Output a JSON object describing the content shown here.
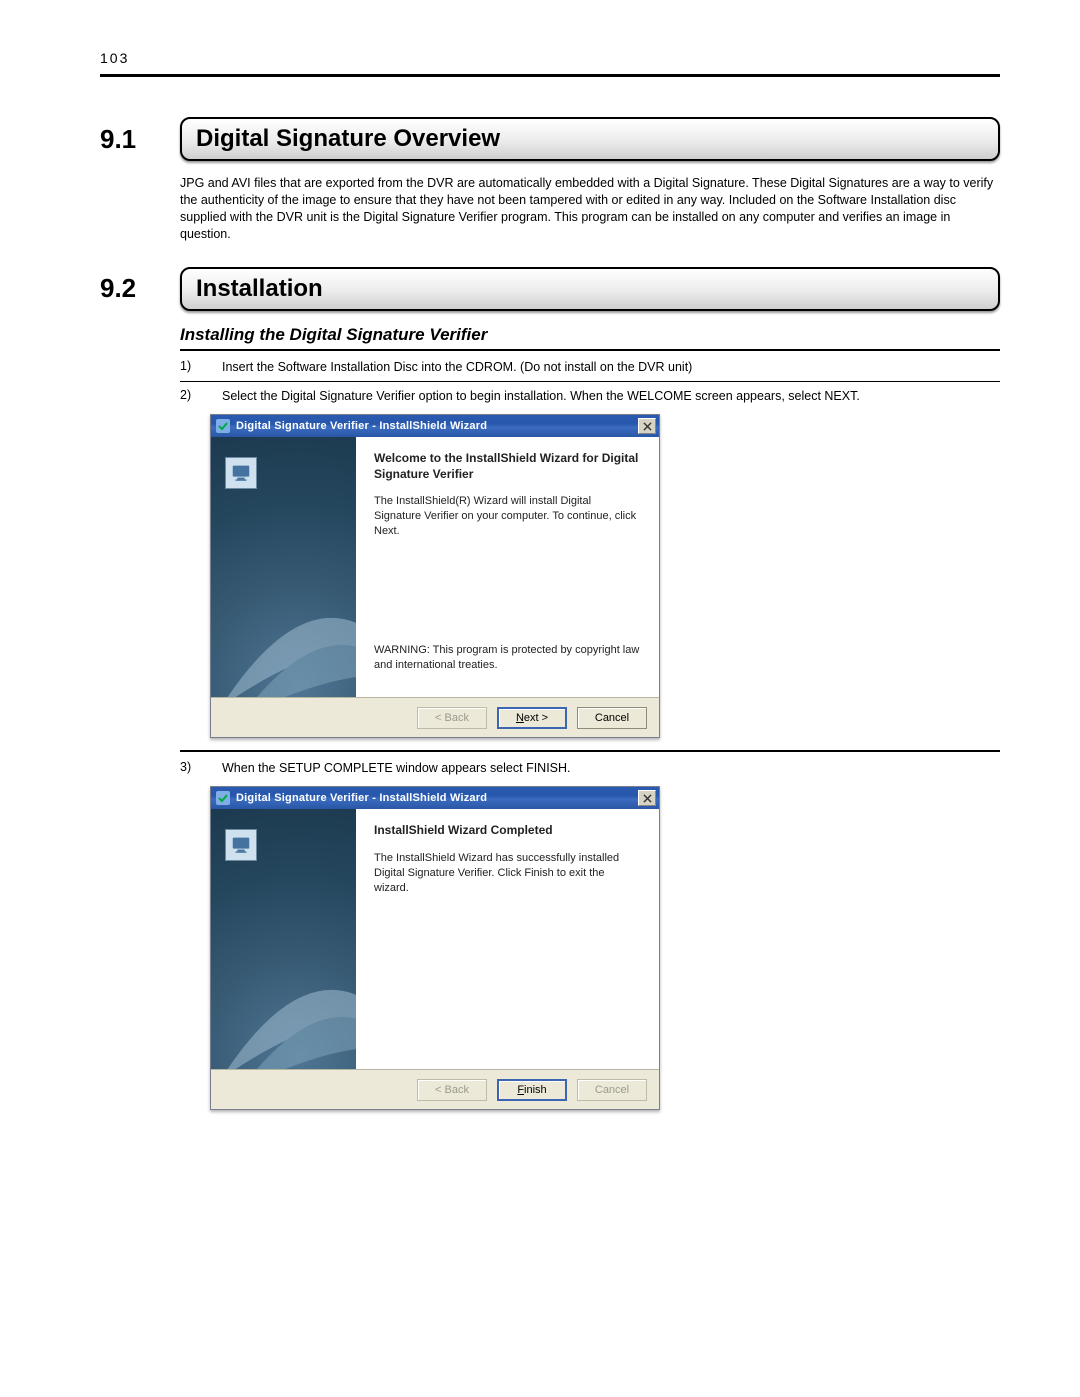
{
  "page_number": "103",
  "sections": {
    "s1": {
      "number": "9.1",
      "title": "Digital Signature Overview"
    },
    "s2": {
      "number": "9.2",
      "title": "Installation"
    }
  },
  "overview_text": "JPG and AVI files that are exported from the DVR are automatically embedded with a Digital Signature. These Digital Signatures are a way to verify the authenticity of the image to ensure that they have not been tampered with or edited in any way. Included on the Software Installation disc supplied with the DVR unit is the Digital Signature Verifier program. This program can be installed on any computer and verifies an image in question.",
  "subhead": "Installing the Digital Signature Verifier",
  "steps": {
    "1": {
      "num": "1)",
      "text": "Insert the Software Installation Disc into the CDROM. (Do not install on the DVR unit)"
    },
    "2": {
      "num": "2)",
      "text": "Select the Digital Signature Verifier option to begin installation. When the WELCOME screen appears, select NEXT."
    },
    "3": {
      "num": "3)",
      "text": "When the SETUP COMPLETE window appears select FINISH."
    }
  },
  "installer1": {
    "titlebar": "Digital Signature Verifier - InstallShield Wizard",
    "heading": "Welcome to the InstallShield Wizard for Digital Signature Verifier",
    "desc": "The InstallShield(R) Wizard will install Digital Signature Verifier on your computer. To continue, click Next.",
    "warning": "WARNING: This program is protected by copyright law and international treaties.",
    "buttons": {
      "back": "< Back",
      "next": "Next >",
      "cancel": "Cancel"
    }
  },
  "installer2": {
    "titlebar": "Digital Signature Verifier - InstallShield Wizard",
    "heading": "InstallShield Wizard Completed",
    "desc": "The InstallShield Wizard has successfully installed Digital Signature Verifier. Click Finish to exit the wizard.",
    "buttons": {
      "back": "< Back",
      "finish": "Finish",
      "cancel": "Cancel"
    }
  }
}
